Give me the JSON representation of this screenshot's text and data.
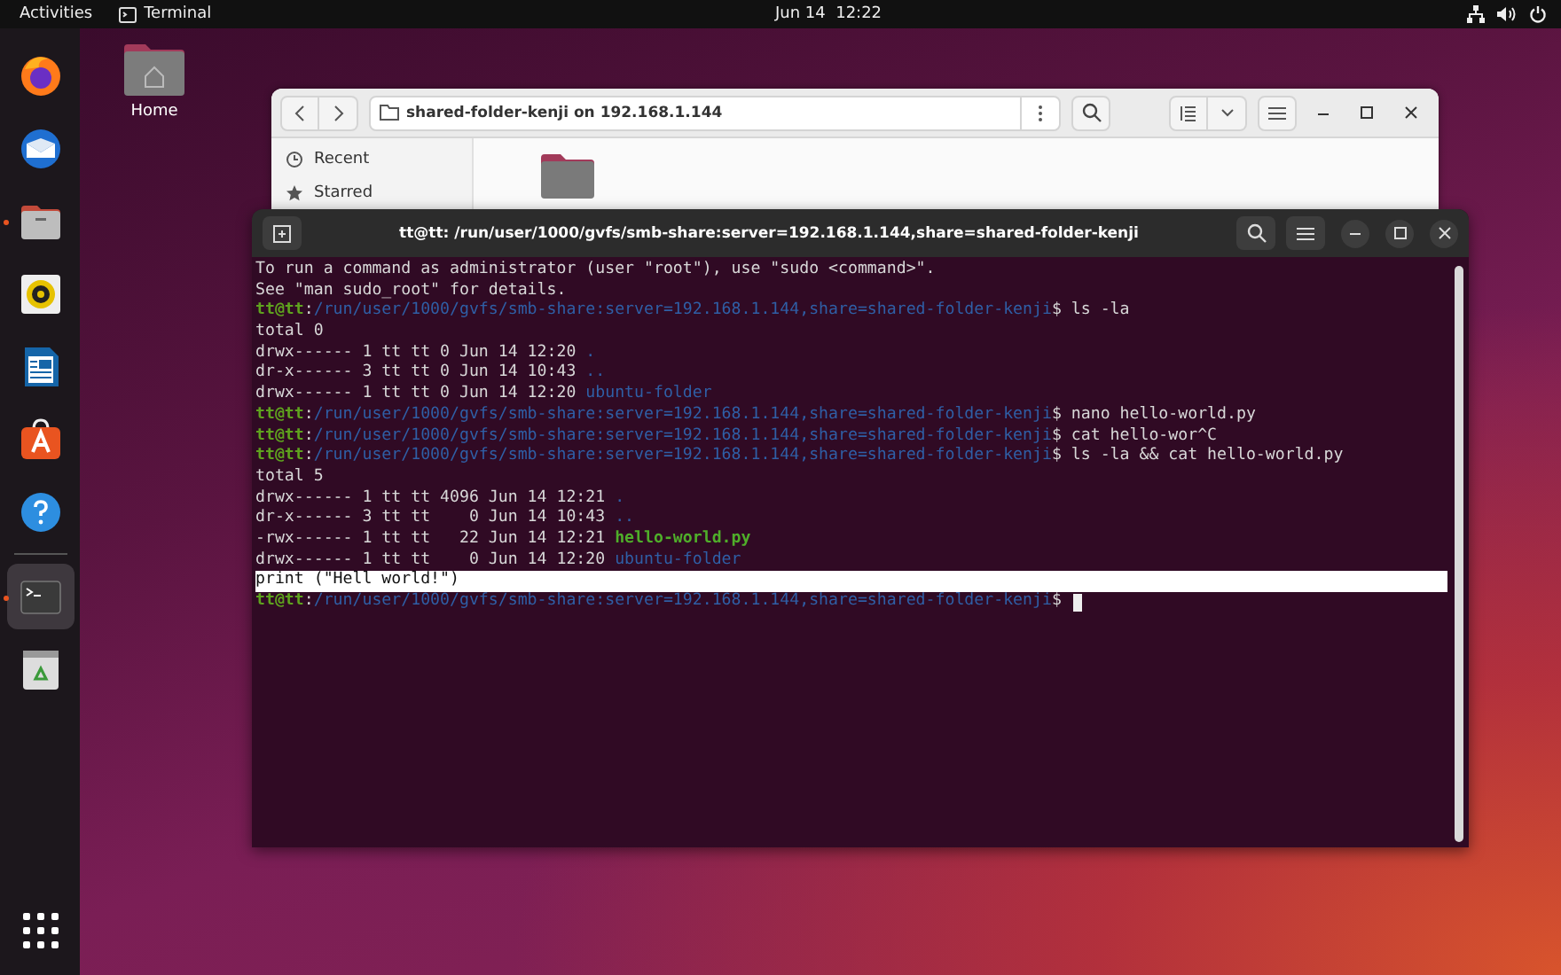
{
  "top_bar": {
    "activities": "Activities",
    "app": "Terminal",
    "clock": "Jun 14  12:22"
  },
  "dock": {
    "items": [
      {
        "kind": "firefox",
        "running": false,
        "selected": false
      },
      {
        "kind": "mail",
        "running": false,
        "selected": false
      },
      {
        "kind": "files",
        "running": true,
        "selected": false
      },
      {
        "kind": "music",
        "running": false,
        "selected": false
      },
      {
        "kind": "writer",
        "running": false,
        "selected": false
      },
      {
        "kind": "store",
        "running": false,
        "selected": false
      },
      {
        "kind": "help",
        "running": false,
        "selected": false
      },
      {
        "kind": "separator"
      },
      {
        "kind": "terminal",
        "running": true,
        "selected": true
      },
      {
        "kind": "trash",
        "running": false,
        "selected": false
      }
    ]
  },
  "desktop_icons": [
    {
      "label": "Home"
    }
  ],
  "files_window": {
    "location": "shared-folder-kenji on 192.168.1.144",
    "sidebar": [
      {
        "label": "Recent"
      },
      {
        "label": "Starred"
      }
    ]
  },
  "terminal": {
    "title": "tt@tt: /run/user/1000/gvfs/smb-share:server=192.168.1.144,share=shared-folder-kenji",
    "lines": [
      {
        "highlighted": false,
        "segments": [
          {
            "kind": "plain",
            "text": "To run a command as administrator (user \"root\"), use \"sudo <command>\"."
          }
        ]
      },
      {
        "highlighted": false,
        "segments": [
          {
            "kind": "plain",
            "text": "See \"man sudo_root\" for details."
          }
        ]
      },
      {
        "highlighted": false,
        "segments": [
          {
            "kind": "user",
            "text": "tt@tt"
          },
          {
            "kind": "plain",
            "text": ":"
          },
          {
            "kind": "path",
            "text": "/run/user/1000/gvfs/smb-share:server=192.168.1.144,share=shared-folder-kenji"
          },
          {
            "kind": "plain",
            "text": "$ ls -la"
          }
        ]
      },
      {
        "highlighted": false,
        "segments": [
          {
            "kind": "plain",
            "text": "total 0"
          }
        ]
      },
      {
        "highlighted": false,
        "segments": [
          {
            "kind": "plain",
            "text": "drwx------ 1 tt tt 0 Jun 14 12:20 "
          },
          {
            "kind": "dir",
            "text": "."
          }
        ]
      },
      {
        "highlighted": false,
        "segments": [
          {
            "kind": "plain",
            "text": "dr-x------ 3 tt tt 0 Jun 14 10:43 "
          },
          {
            "kind": "dir",
            "text": ".."
          }
        ]
      },
      {
        "highlighted": false,
        "segments": [
          {
            "kind": "plain",
            "text": "drwx------ 1 tt tt 0 Jun 14 12:20 "
          },
          {
            "kind": "dir",
            "text": "ubuntu-folder"
          }
        ]
      },
      {
        "highlighted": false,
        "segments": [
          {
            "kind": "user",
            "text": "tt@tt"
          },
          {
            "kind": "plain",
            "text": ":"
          },
          {
            "kind": "path",
            "text": "/run/user/1000/gvfs/smb-share:server=192.168.1.144,share=shared-folder-kenji"
          },
          {
            "kind": "plain",
            "text": "$ nano hello-world.py"
          }
        ]
      },
      {
        "highlighted": false,
        "segments": [
          {
            "kind": "user",
            "text": "tt@tt"
          },
          {
            "kind": "plain",
            "text": ":"
          },
          {
            "kind": "path",
            "text": "/run/user/1000/gvfs/smb-share:server=192.168.1.144,share=shared-folder-kenji"
          },
          {
            "kind": "plain",
            "text": "$ cat hello-wor^C"
          }
        ]
      },
      {
        "highlighted": false,
        "segments": [
          {
            "kind": "user",
            "text": "tt@tt"
          },
          {
            "kind": "plain",
            "text": ":"
          },
          {
            "kind": "path",
            "text": "/run/user/1000/gvfs/smb-share:server=192.168.1.144,share=shared-folder-kenji"
          },
          {
            "kind": "plain",
            "text": "$ ls -la && cat hello-world.py"
          }
        ]
      },
      {
        "highlighted": false,
        "segments": [
          {
            "kind": "plain",
            "text": "total 5"
          }
        ]
      },
      {
        "highlighted": false,
        "segments": [
          {
            "kind": "plain",
            "text": "drwx------ 1 tt tt 4096 Jun 14 12:21 "
          },
          {
            "kind": "dir",
            "text": "."
          }
        ]
      },
      {
        "highlighted": false,
        "segments": [
          {
            "kind": "plain",
            "text": "dr-x------ 3 tt tt    0 Jun 14 10:43 "
          },
          {
            "kind": "dir",
            "text": ".."
          }
        ]
      },
      {
        "highlighted": false,
        "segments": [
          {
            "kind": "plain",
            "text": "-rwx------ 1 tt tt   22 Jun 14 12:21 "
          },
          {
            "kind": "exec",
            "text": "hello-world.py"
          }
        ]
      },
      {
        "highlighted": false,
        "segments": [
          {
            "kind": "plain",
            "text": "drwx------ 1 tt tt    0 Jun 14 12:20 "
          },
          {
            "kind": "dir",
            "text": "ubuntu-folder"
          }
        ]
      },
      {
        "highlighted": true,
        "segments": [
          {
            "kind": "plain",
            "text": "print (\"Hell world!\")"
          }
        ]
      },
      {
        "highlighted": false,
        "cursor": true,
        "segments": [
          {
            "kind": "user",
            "text": "tt@tt"
          },
          {
            "kind": "plain",
            "text": ":"
          },
          {
            "kind": "path",
            "text": "/run/user/1000/gvfs/smb-share:server=192.168.1.144,share=shared-folder-kenji"
          },
          {
            "kind": "plain",
            "text": "$ "
          }
        ]
      }
    ]
  }
}
